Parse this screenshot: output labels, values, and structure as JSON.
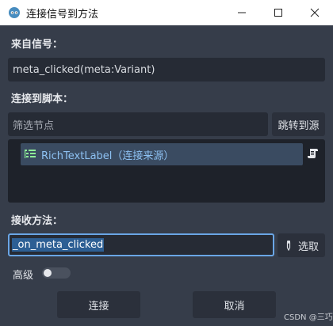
{
  "window": {
    "title": "连接信号到方法",
    "controls": [
      "minimize-icon",
      "maximize-icon",
      "close-icon"
    ]
  },
  "signal_section": {
    "label": "来自信号：",
    "value": "meta_clicked(meta:Variant)"
  },
  "script_section": {
    "label": "连接到脚本：",
    "filter_placeholder": "筛选节点",
    "jump_button": "跳转到源",
    "tree_items": [
      {
        "icon": "richtextlabel-node-icon",
        "label": "RichTextLabel（连接来源）",
        "has_script": true
      }
    ]
  },
  "method_section": {
    "label": "接收方法：",
    "value": "_on_meta_clicked",
    "pick_button": "选取"
  },
  "advanced": {
    "label": "高级",
    "enabled": false
  },
  "footer": {
    "connect_button": "连接",
    "cancel_button": "取消"
  },
  "watermark": "CSDN @三巧",
  "colors": {
    "background": "#363d4a",
    "field": "#262b35",
    "accent": "#6aa6e6",
    "selection": "#3a4b61",
    "node_text": "#8dc1f2"
  }
}
